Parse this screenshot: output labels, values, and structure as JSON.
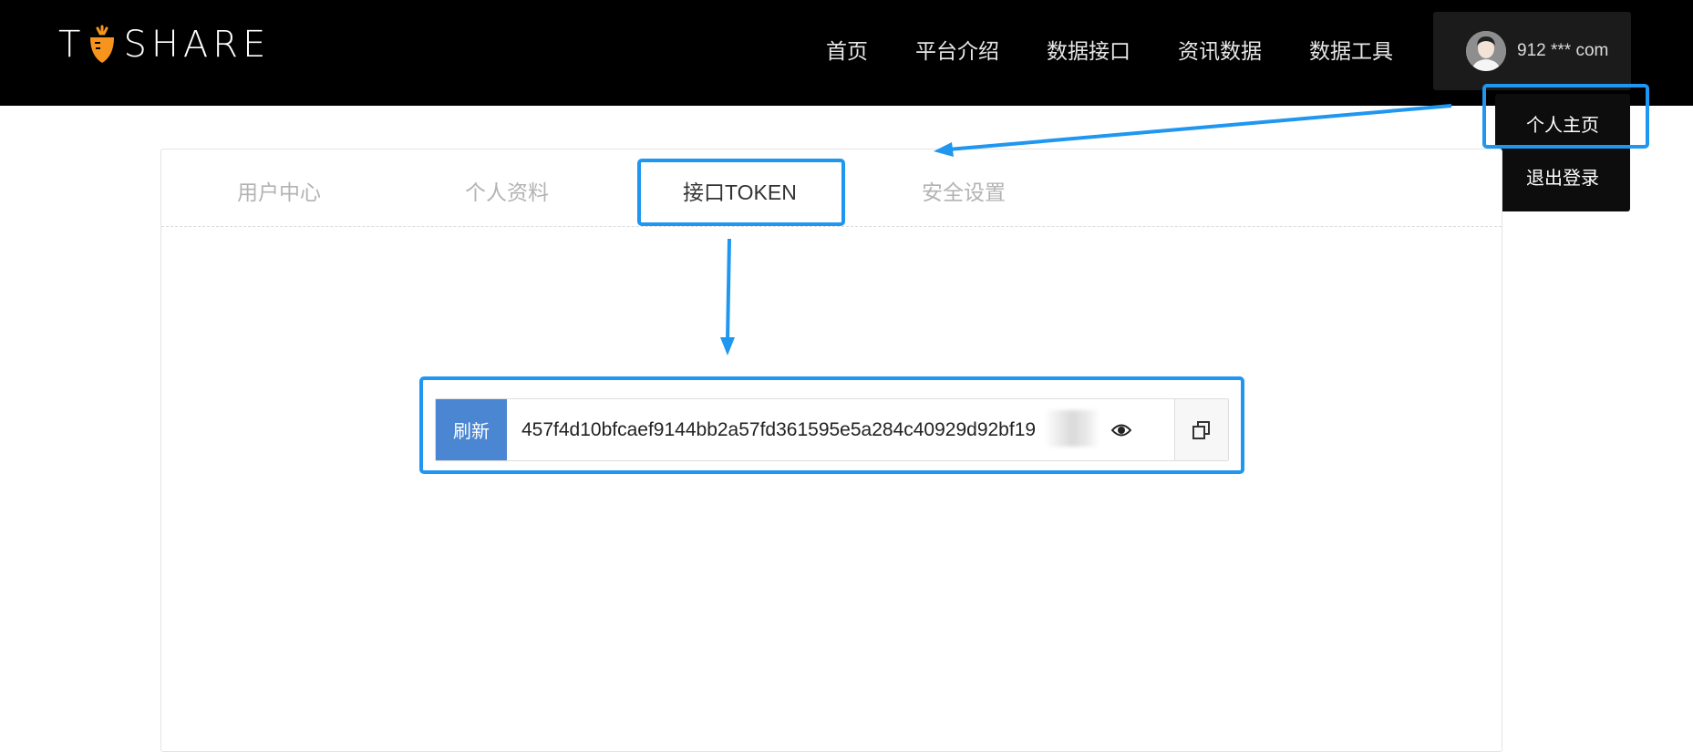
{
  "brand": {
    "logo_text_left": "T",
    "logo_text_right": "SHARE",
    "accent_color": "#f7941d"
  },
  "nav": {
    "items": [
      {
        "label": "首页"
      },
      {
        "label": "平台介绍"
      },
      {
        "label": "数据接口"
      },
      {
        "label": "资讯数据"
      },
      {
        "label": "数据工具"
      }
    ]
  },
  "user": {
    "name": "912 *** com",
    "avatar_icon": "user-avatar-icon"
  },
  "dropdown": {
    "items": [
      {
        "label": "个人主页"
      },
      {
        "label": "退出登录"
      }
    ]
  },
  "tabs": [
    {
      "label": "用户中心"
    },
    {
      "label": "个人资料"
    },
    {
      "label": "接口TOKEN"
    },
    {
      "label": "安全设置"
    }
  ],
  "token": {
    "refresh_label": "刷新",
    "value": "457f4d10bfcaef9144bb2a57fd361595e5a284c40929d92bf19",
    "eye_icon": "eye-icon",
    "copy_icon": "copy-icon"
  },
  "annotation_color": "#1f96f0"
}
